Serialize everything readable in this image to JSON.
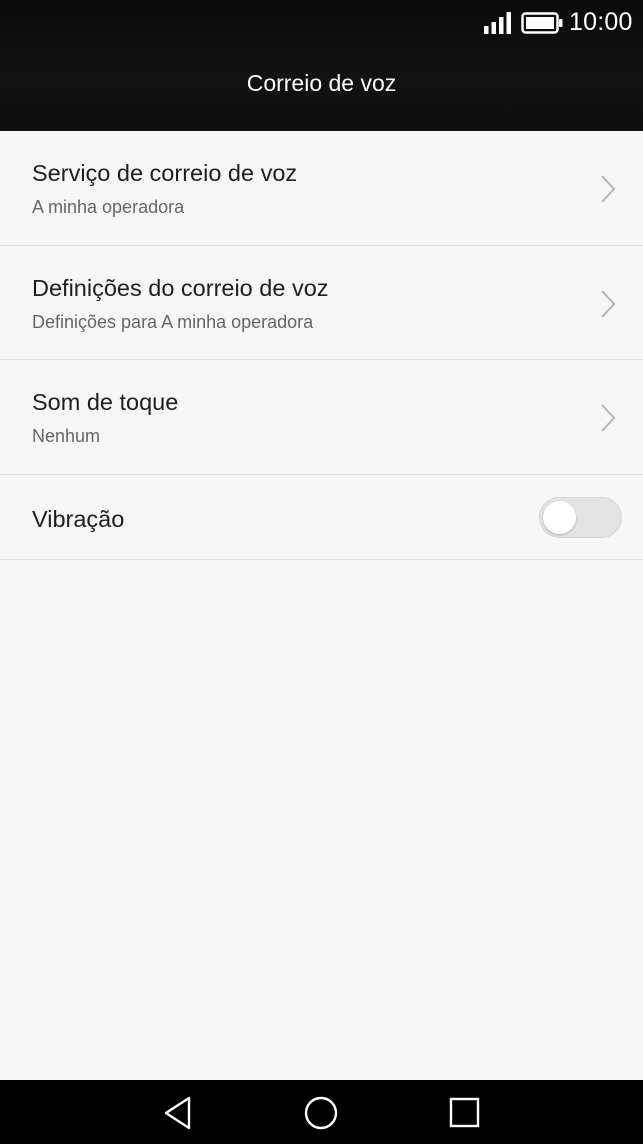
{
  "status_bar": {
    "time": "10:00",
    "icons": [
      "signal-icon",
      "battery-icon"
    ]
  },
  "header": {
    "title": "Correio de voz"
  },
  "settings": {
    "voicemail_service": {
      "title": "Serviço de correio de voz",
      "subtitle": "A minha operadora",
      "icon": "chevron-right-icon"
    },
    "voicemail_settings": {
      "title": "Definições do correio de voz",
      "subtitle": "Definições para A minha operadora",
      "icon": "chevron-right-icon"
    },
    "ringtone": {
      "title": "Som de toque",
      "subtitle": "Nenhum",
      "icon": "chevron-right-icon"
    },
    "vibration": {
      "title": "Vibração",
      "enabled": false
    }
  },
  "nav_bar": {
    "icons": [
      "back-triangle-icon",
      "home-circle-icon",
      "recents-square-icon"
    ]
  },
  "colors": {
    "header_bg": "#0d0d0d",
    "page_bg": "#f7f7f7",
    "divider": "#dedede",
    "title_text": "#1e1e1e",
    "subtitle_text": "#666666",
    "toggle_off_track": "#e3e3e3"
  }
}
